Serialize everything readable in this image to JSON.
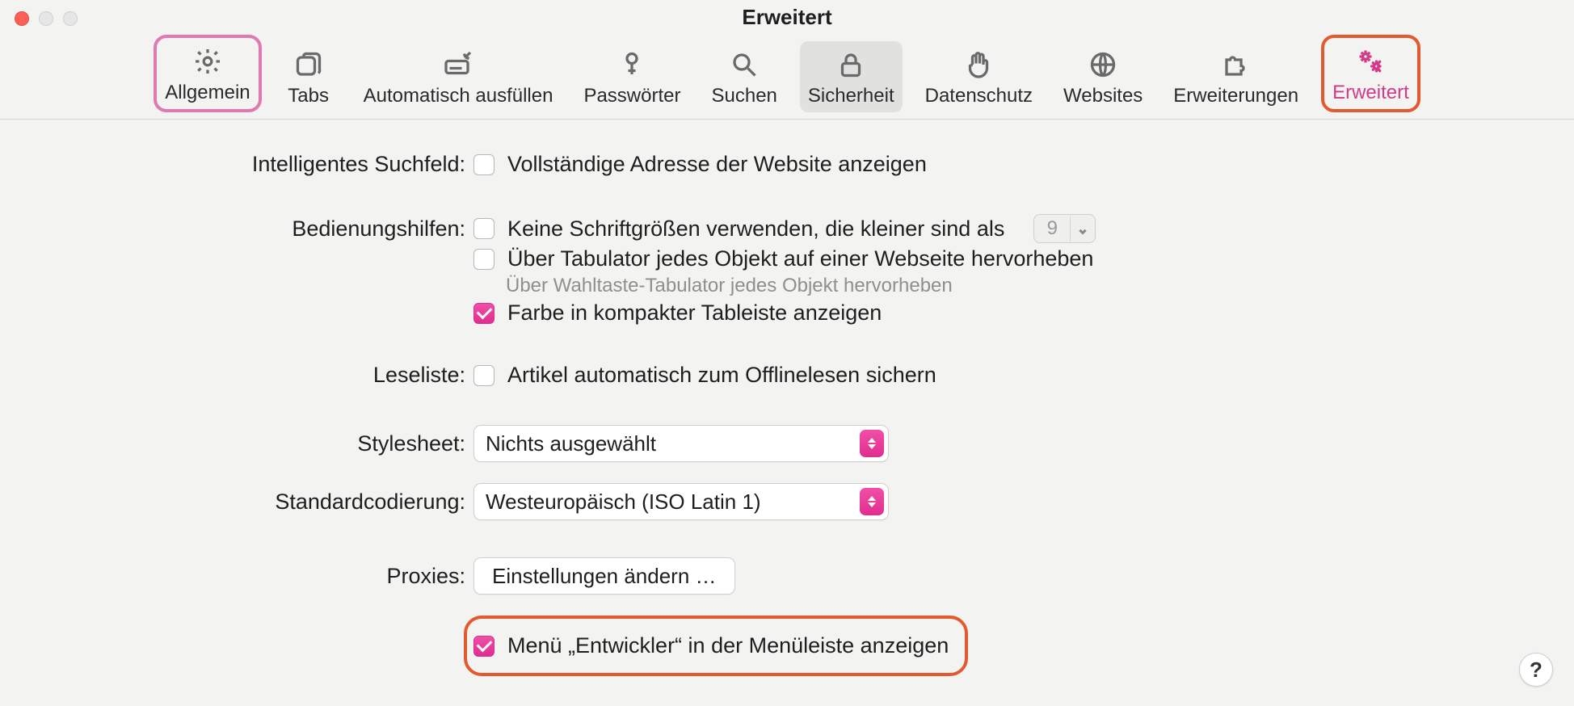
{
  "window": {
    "title": "Erweitert"
  },
  "toolbar": {
    "general": "Allgemein",
    "tabs": "Tabs",
    "autofill": "Automatisch ausfüllen",
    "passwords": "Passwörter",
    "search": "Suchen",
    "security": "Sicherheit",
    "privacy": "Datenschutz",
    "websites": "Websites",
    "extensions": "Erweiterungen",
    "advanced": "Erweitert"
  },
  "form": {
    "smart_search_label": "Intelligentes Suchfeld:",
    "show_full_url": "Vollständige Adresse der Website anzeigen",
    "accessibility_label": "Bedienungshilfen:",
    "no_small_fonts": "Keine Schriftgrößen verwenden, die kleiner sind als",
    "min_font_value": "9",
    "tab_highlight": "Über Tabulator jedes Objekt auf einer Webseite hervorheben",
    "tab_highlight_hint": "Über Wahltaste-Tabulator jedes Objekt hervorheben",
    "compact_tab_color": "Farbe in kompakter Tableiste anzeigen",
    "readinglist_label": "Leseliste:",
    "readinglist_offline": "Artikel automatisch zum Offlinelesen sichern",
    "stylesheet_label": "Stylesheet:",
    "stylesheet_value": "Nichts ausgewählt",
    "encoding_label": "Standardcodierung:",
    "encoding_value": "Westeuropäisch (ISO Latin 1)",
    "proxies_label": "Proxies:",
    "proxies_button": "Einstellungen ändern …",
    "developer_menu": "Menü „Entwickler“ in der Menüleiste anzeigen"
  },
  "help": "?"
}
